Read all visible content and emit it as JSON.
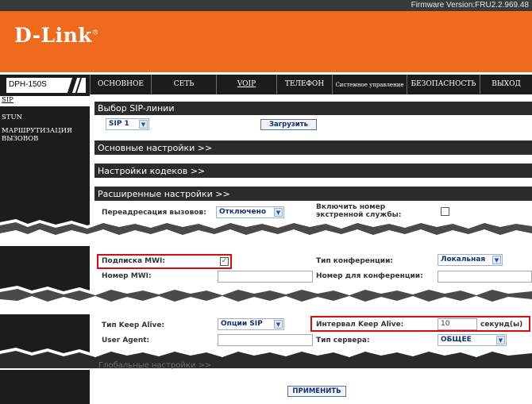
{
  "firmware": "Firmware Version:FRU2.2.969.48",
  "logo": "D-Link",
  "model": "DPH-150S",
  "tabs": [
    {
      "label": "ОСНОВНОЕ"
    },
    {
      "label": "СЕТЬ"
    },
    {
      "label": "VOIP"
    },
    {
      "label": "ТЕЛЕФОН"
    },
    {
      "label": "Системное управление"
    },
    {
      "label": "БЕЗОПАСНОСТЬ"
    },
    {
      "label": "ВЫХОД"
    }
  ],
  "sidebar": {
    "items": [
      {
        "label": "SIP"
      },
      {
        "label": "STUN"
      },
      {
        "label": "МАРШРУТИЗАЦИЯ ВЫЗОВОВ"
      }
    ]
  },
  "sections": {
    "sip_line": "Выбор SIP-линии",
    "basic": "Основные настройки >>",
    "codecs": "Настройки кодеков >>",
    "advanced": "Расширенные настройки >>",
    "global_partial": "Глобальные настройки >>"
  },
  "sip_line": {
    "select": "SIP 1",
    "load_button": "Загрузить"
  },
  "adv": {
    "forward_label": "Переадресация вызовов:",
    "forward_value": "Отключено",
    "emergency_label": "Включить номер экстренной службы:",
    "mwi_sub_label": "Подписка MWI:",
    "mwi_checked": "✓",
    "conf_type_label": "Тип конференции:",
    "conf_type_value": "Локальная",
    "mwi_number_label": "Номер MWI:",
    "conf_number_label": "Номер для конференции:",
    "keepalive_type_label": "Тип Keep Alive:",
    "keepalive_type_value": "Опции SIP",
    "keepalive_interval_label": "Интервал Keep Alive:",
    "keepalive_interval_value": "10",
    "keepalive_unit": "секунд(ы)",
    "user_agent_label": "User Agent:",
    "server_type_label": "Тип сервера:",
    "server_type_value": "ОБЩЕЕ"
  },
  "apply_button": "ПРИМЕНИТЬ",
  "colors": {
    "orange": "#f06a1d",
    "dark": "#1c1c1c",
    "highlight": "#d80c0c"
  }
}
